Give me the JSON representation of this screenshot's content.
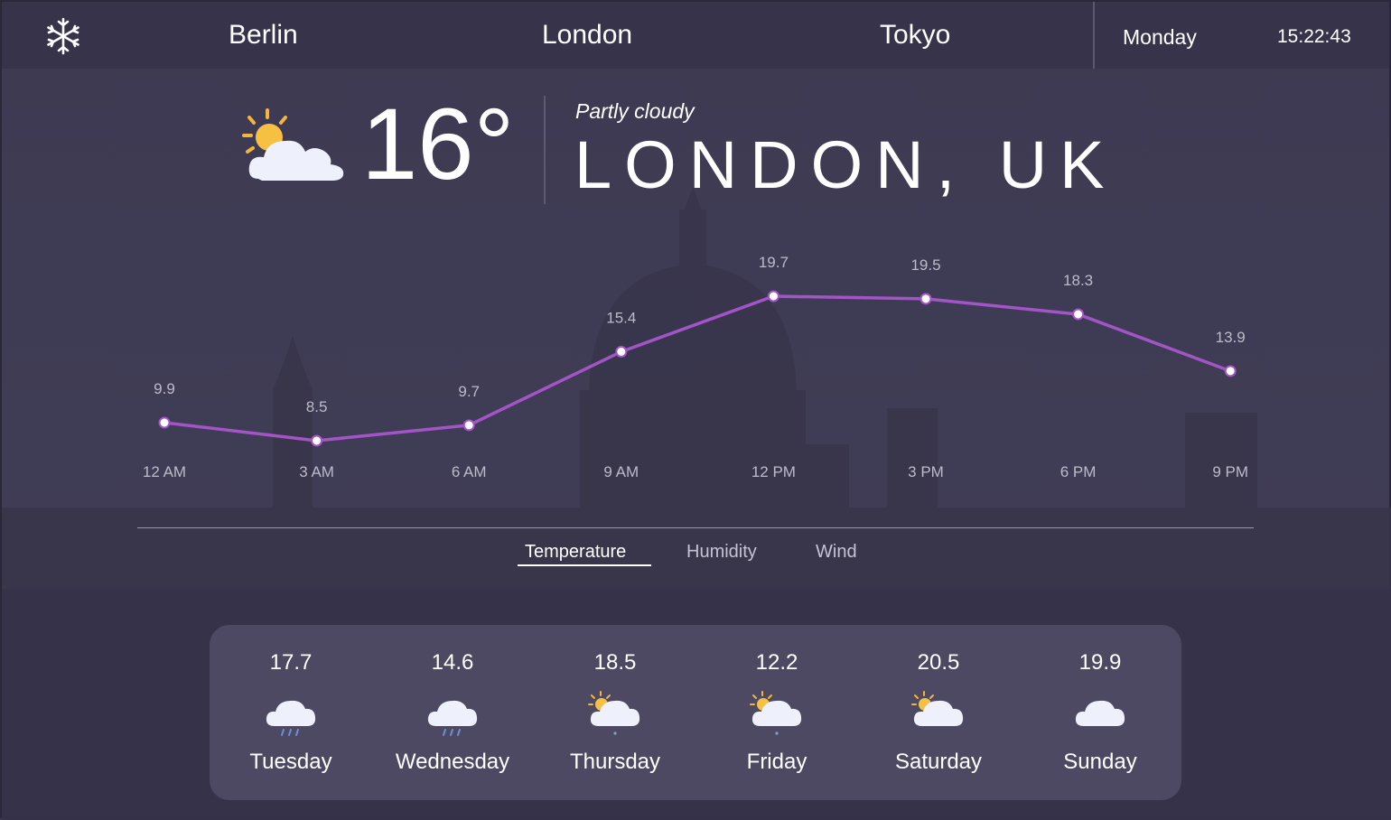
{
  "nav": {
    "menu_icon": "snowflake-icon",
    "cities": [
      "Berlin",
      "London",
      "Tokyo"
    ],
    "day": "Monday",
    "time": "15:22:43"
  },
  "current": {
    "icon": "partly-cloudy-icon",
    "temperature": "16°",
    "condition": "Partly cloudy",
    "location": "LONDON, UK"
  },
  "chart_data": {
    "type": "line",
    "categories": [
      "12 AM",
      "3 AM",
      "6 AM",
      "9 AM",
      "12 PM",
      "3 PM",
      "6 PM",
      "9 PM"
    ],
    "values": [
      9.9,
      8.5,
      9.7,
      15.4,
      19.7,
      19.5,
      18.3,
      13.9
    ],
    "color": "#a354c6"
  },
  "chart_tabs": [
    "Temperature",
    "Humidity",
    "Wind"
  ],
  "active_tab": "Temperature",
  "forecast": [
    {
      "value": "17.7",
      "day": "Tuesday",
      "icon": "rain-cloud-icon"
    },
    {
      "value": "14.6",
      "day": "Wednesday",
      "icon": "rain-cloud-icon"
    },
    {
      "value": "18.5",
      "day": "Thursday",
      "icon": "sun-cloud-drizzle-icon"
    },
    {
      "value": "12.2",
      "day": "Friday",
      "icon": "sun-cloud-drizzle-icon"
    },
    {
      "value": "20.5",
      "day": "Saturday",
      "icon": "partly-cloudy-icon"
    },
    {
      "value": "19.9",
      "day": "Sunday",
      "icon": "cloud-icon"
    }
  ]
}
